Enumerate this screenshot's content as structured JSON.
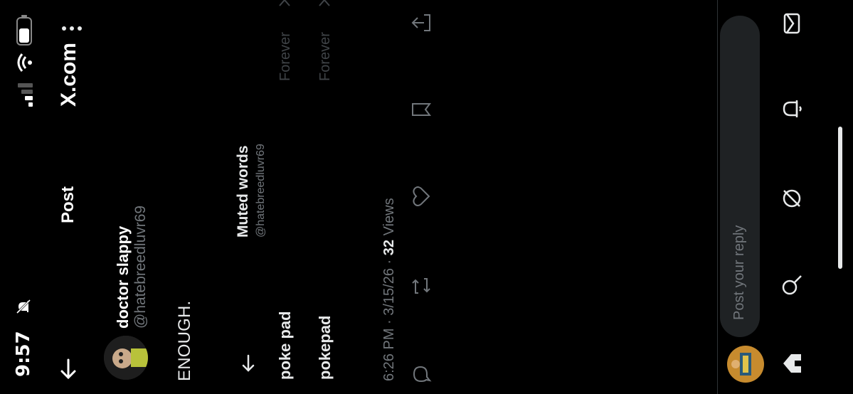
{
  "status_bar": {
    "time": "9:57"
  },
  "header": {
    "title": "Post",
    "brand": "X.com"
  },
  "post": {
    "author_name": "doctor slappy",
    "author_handle": "@hatebreedluvr69",
    "text": "ENOUGH.",
    "timestamp": "6:26 PM · 3/15/26 ·",
    "views_count": "32",
    "views_label": "Views"
  },
  "muted_panel": {
    "title": "Muted words",
    "handle": "@hatebreedluvr69",
    "words": [
      {
        "word": "poke pad",
        "duration": "Forever"
      },
      {
        "word": "pokepad",
        "duration": "Forever"
      }
    ]
  },
  "reply": {
    "placeholder": "Post your reply"
  },
  "icons": {
    "back": "arrow-left-icon",
    "more": "more-vertical-icon",
    "reply": "reply-icon",
    "repost": "repost-icon",
    "like": "heart-icon",
    "bookmark": "bookmark-icon",
    "share": "share-icon",
    "home": "home-icon",
    "search": "search-icon",
    "grok": "grok-icon",
    "notifications": "bell-icon",
    "messages": "mail-icon"
  }
}
